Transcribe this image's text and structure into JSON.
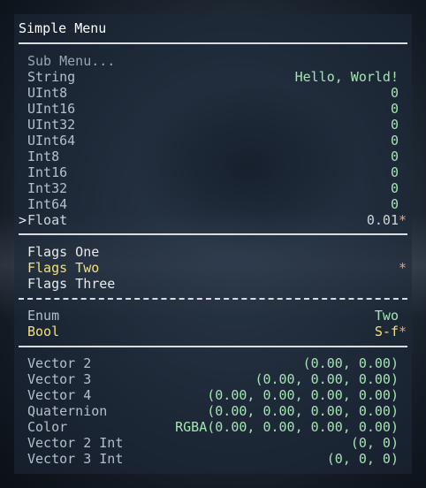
{
  "menu": {
    "title": "Simple Menu",
    "cursor_glyph": ">",
    "items": [
      {
        "label": "Sub Menu...",
        "value": "",
        "mark": "",
        "state": "dim",
        "cursor": false
      },
      {
        "label": "String",
        "value": "Hello, World!",
        "mark": "",
        "state": "normal",
        "cursor": false
      },
      {
        "label": "UInt8",
        "value": "0",
        "mark": "",
        "state": "normal",
        "cursor": false
      },
      {
        "label": "UInt16",
        "value": "0",
        "mark": "",
        "state": "normal",
        "cursor": false
      },
      {
        "label": "UInt32",
        "value": "0",
        "mark": "",
        "state": "normal",
        "cursor": false
      },
      {
        "label": "UInt64",
        "value": "0",
        "mark": "",
        "state": "normal",
        "cursor": false
      },
      {
        "label": "Int8",
        "value": "0",
        "mark": "",
        "state": "normal",
        "cursor": false
      },
      {
        "label": "Int16",
        "value": "0",
        "mark": "",
        "state": "normal",
        "cursor": false
      },
      {
        "label": "Int32",
        "value": "0",
        "mark": "",
        "state": "normal",
        "cursor": false
      },
      {
        "label": "Int64",
        "value": "0",
        "mark": "",
        "state": "normal",
        "cursor": false
      },
      {
        "label": "Float",
        "value": "0.01",
        "mark": "*",
        "state": "selected",
        "cursor": true
      },
      {
        "label": "Flags One",
        "value": "",
        "mark": "",
        "state": "bright",
        "cursor": false
      },
      {
        "label": "Flags Two",
        "value": "",
        "mark": "*",
        "state": "highlight",
        "cursor": false
      },
      {
        "label": "Flags Three",
        "value": "",
        "mark": "",
        "state": "bright",
        "cursor": false
      },
      {
        "label": "Enum",
        "value": "Two",
        "mark": "",
        "state": "normal",
        "cursor": false
      },
      {
        "label": "Bool",
        "value": "S-f",
        "mark": "*",
        "state": "highlight",
        "cursor": false
      },
      {
        "label": "Vector 2",
        "value": "(0.00, 0.00)",
        "mark": "",
        "state": "normal",
        "cursor": false
      },
      {
        "label": "Vector 3",
        "value": "(0.00, 0.00, 0.00)",
        "mark": "",
        "state": "normal",
        "cursor": false
      },
      {
        "label": "Vector 4",
        "value": "(0.00, 0.00, 0.00, 0.00)",
        "mark": "",
        "state": "normal",
        "cursor": false
      },
      {
        "label": "Quaternion",
        "value": "(0.00, 0.00, 0.00, 0.00)",
        "mark": "",
        "state": "normal",
        "cursor": false
      },
      {
        "label": "Color",
        "value": "RGBA(0.00, 0.00, 0.00, 0.00)",
        "mark": "",
        "state": "normal",
        "cursor": false
      },
      {
        "label": "Vector 2 Int",
        "value": "(0, 0)",
        "mark": "",
        "state": "normal",
        "cursor": false
      },
      {
        "label": "Vector 3 Int",
        "value": "(0, 0, 0)",
        "mark": "",
        "state": "normal",
        "cursor": false
      }
    ]
  },
  "colors": {
    "panel": "#1e2a3a",
    "title": "#ffffff",
    "divider": "#d9dde3",
    "label_normal": "#b4c0cc",
    "label_dim": "#9aa6b2",
    "label_bright": "#e6e9ee",
    "value": "#a6e3b4",
    "highlight": "#f2e07a",
    "selected": "#cfd5db",
    "mark": "#f0a06a"
  }
}
